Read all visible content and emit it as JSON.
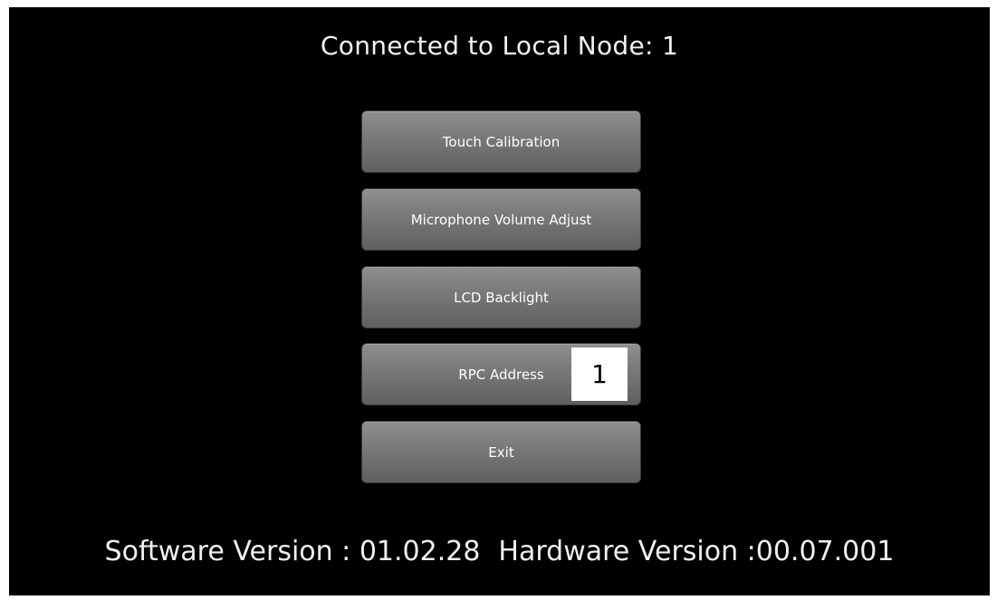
{
  "header": {
    "title": "Connected to Local Node: 1"
  },
  "menu": {
    "touch_calibration": "Touch Calibration",
    "microphone_volume": "Microphone Volume Adjust",
    "lcd_backlight": "LCD Backlight",
    "rpc_address_label": "RPC Address",
    "rpc_address_value": "1",
    "exit": "Exit"
  },
  "footer": {
    "software_version": "Software Version : 01.02.28",
    "hardware_version": "Hardware Version :00.07.001"
  },
  "colors": {
    "background": "#000000",
    "button": "#787878",
    "text": "#ffffff"
  }
}
